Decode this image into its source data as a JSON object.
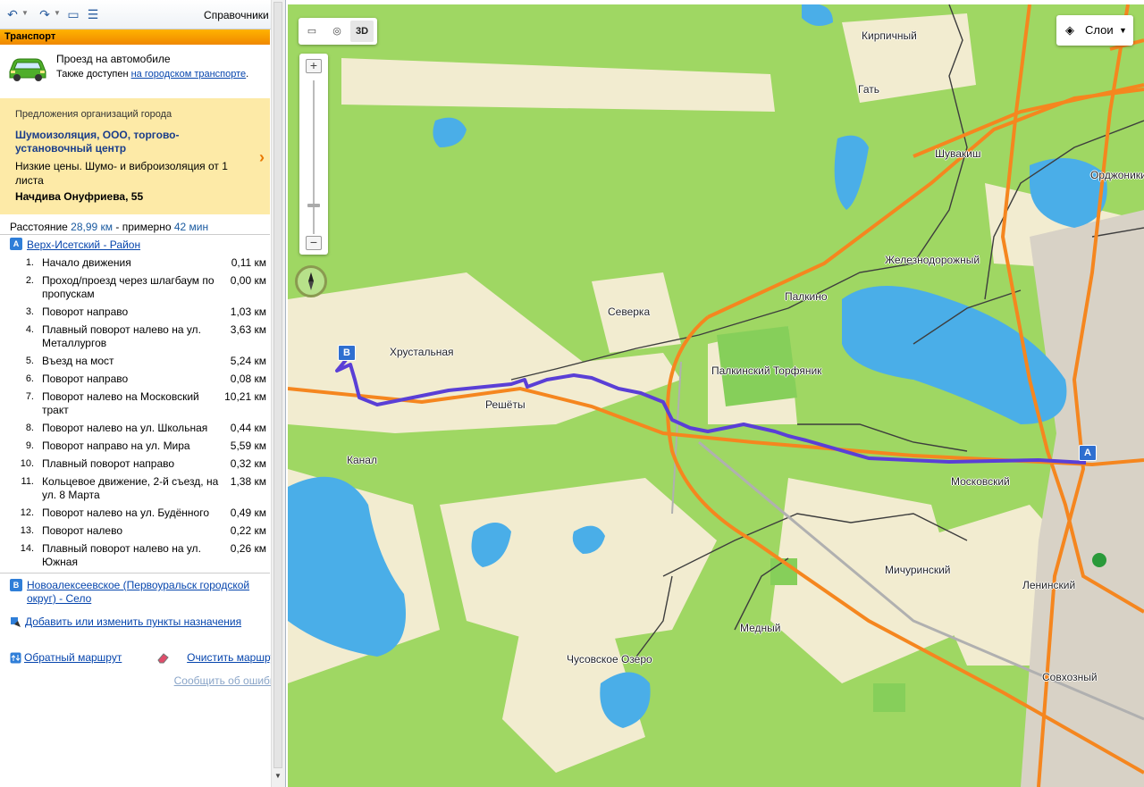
{
  "toolbar": {
    "directory_label": "Справочники"
  },
  "transport": {
    "header": "Транспорт",
    "mode_title": "Проезд на автомобиле",
    "also_text": "Также доступен",
    "also_link": "на городском транспорте",
    "also_end": "."
  },
  "ad": {
    "caption": "Предложения организаций города",
    "title": "Шумоизоляция, ООО, торгово-установочный центр",
    "text": "Низкие цены. Шумо- и виброизоляция от 1 листа",
    "address": "Начдива Онуфриева, 55"
  },
  "summary": {
    "distance_label": "Расстояние",
    "distance": "28,99 км",
    "about": "- примерно",
    "time": "42 мин"
  },
  "route": {
    "start_pin": "A",
    "start_name": "Верх-Исетский - Район",
    "end_pin": "B",
    "end_name": "Новоалексеевское (Первоуральск городской округ) - Село",
    "steps": [
      {
        "num": "1.",
        "text": "Начало движения",
        "dist": "0,11 км"
      },
      {
        "num": "2.",
        "text": "Проход/проезд через шлагбаум по пропускам",
        "dist": "0,00 км"
      },
      {
        "num": "3.",
        "text": "Поворот направо",
        "dist": "1,03 км"
      },
      {
        "num": "4.",
        "text": "Плавный поворот налево на ул. Металлургов",
        "dist": "3,63 км"
      },
      {
        "num": "5.",
        "text": "Въезд на мост",
        "dist": "5,24 км"
      },
      {
        "num": "6.",
        "text": "Поворот направо",
        "dist": "0,08 км"
      },
      {
        "num": "7.",
        "text": "Поворот налево на Московский тракт",
        "dist": "10,21 км"
      },
      {
        "num": "8.",
        "text": "Поворот налево на ул. Школьная",
        "dist": "0,44 км"
      },
      {
        "num": "9.",
        "text": "Поворот направо на ул. Мира",
        "dist": "5,59 км"
      },
      {
        "num": "10.",
        "text": "Плавный поворот направо",
        "dist": "0,32 км"
      },
      {
        "num": "11.",
        "text": "Кольцевое движение, 2-й съезд, на ул. 8 Марта",
        "dist": "1,38 км"
      },
      {
        "num": "12.",
        "text": "Поворот налево на ул. Будённого",
        "dist": "0,49 км"
      },
      {
        "num": "13.",
        "text": "Поворот налево",
        "dist": "0,22 км"
      },
      {
        "num": "14.",
        "text": "Плавный поворот налево на ул. Южная",
        "dist": "0,26 км"
      }
    ]
  },
  "actions": {
    "add_dest": "Добавить или изменить пункты назначения",
    "reverse": "Обратный маршрут",
    "clear": "Очистить маршрут",
    "report": "Сообщить об ошибке"
  },
  "map": {
    "tools": {
      "ruler": "ruler-icon",
      "traffic": "traffic-icon",
      "three_d": "3D"
    },
    "layers_label": "Слои",
    "pin_a": "A",
    "pin_b": "B",
    "labels": {
      "kirpichny": "Кирпичный",
      "gat": "Гать",
      "shuvakish": "Шувакиш",
      "ordzhonikidze": "Орджоники",
      "zheleznodorozhny": "Железнодорожный",
      "palkino": "Палкино",
      "severka": "Северка",
      "khrustalnaya": "Хрустальная",
      "reshety": "Решёты",
      "palkinsky": "Палкинский Торфяник",
      "kanal": "Канал",
      "moskovsky": "Московский",
      "michurinsky": "Мичуринский",
      "leninsky": "Ленинский",
      "medny": "Медный",
      "chusovskoe": "Чусовское Озеро",
      "sovkhozny": "Совхозный"
    },
    "colors": {
      "route": "#5a3fd6",
      "water": "#4aaee8",
      "road": "#f5861f",
      "grass": "#9fd763"
    }
  }
}
